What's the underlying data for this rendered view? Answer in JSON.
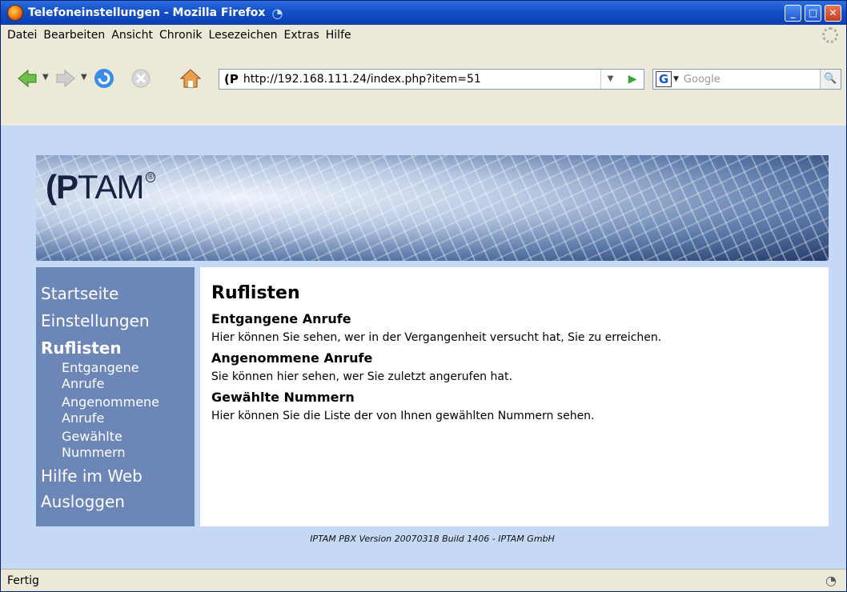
{
  "window": {
    "title": "Telefoneinstellungen - Mozilla Firefox"
  },
  "menu": [
    "Datei",
    "Bearbeiten",
    "Ansicht",
    "Chronik",
    "Lesezeichen",
    "Extras",
    "Hilfe"
  ],
  "address": {
    "favicon_text": "(P",
    "url": "http://192.168.111.24/index.php?item=51"
  },
  "search": {
    "placeholder": "Google",
    "engine_letter": "G"
  },
  "header": {
    "logo_bold": "(P",
    "logo_rest": "TAM",
    "logo_mark": "®"
  },
  "sidebar": {
    "items": [
      {
        "label": "Startseite",
        "level": "top"
      },
      {
        "label": "Einstellungen",
        "level": "top"
      },
      {
        "label": "Ruflisten",
        "level": "top",
        "active": true
      },
      {
        "label": "Entgangene",
        "level": "sub"
      },
      {
        "label": "Anrufe",
        "level": "sub"
      },
      {
        "label": "Angenommene",
        "level": "sub"
      },
      {
        "label": "Anrufe",
        "level": "sub"
      },
      {
        "label": "Gewählte",
        "level": "sub"
      },
      {
        "label": "Nummern",
        "level": "sub"
      },
      {
        "label": "Hilfe im Web",
        "level": "top"
      },
      {
        "label": "Ausloggen",
        "level": "top"
      }
    ]
  },
  "main": {
    "title": "Ruflisten",
    "sections": [
      {
        "heading": "Entgangene Anrufe",
        "text": "Hier können Sie sehen, wer in der Vergangenheit versucht hat, Sie zu erreichen."
      },
      {
        "heading": "Angenommene Anrufe",
        "text": "Sie können hier sehen, wer Sie zuletzt angerufen hat."
      },
      {
        "heading": "Gewählte Nummern",
        "text": "Hier können Sie die Liste der von Ihnen gewählten Nummern sehen."
      }
    ]
  },
  "footer": {
    "text": "IPTAM PBX Version 20070318 Build 1406 - IPTAM GmbH"
  },
  "status": {
    "text": "Fertig"
  }
}
